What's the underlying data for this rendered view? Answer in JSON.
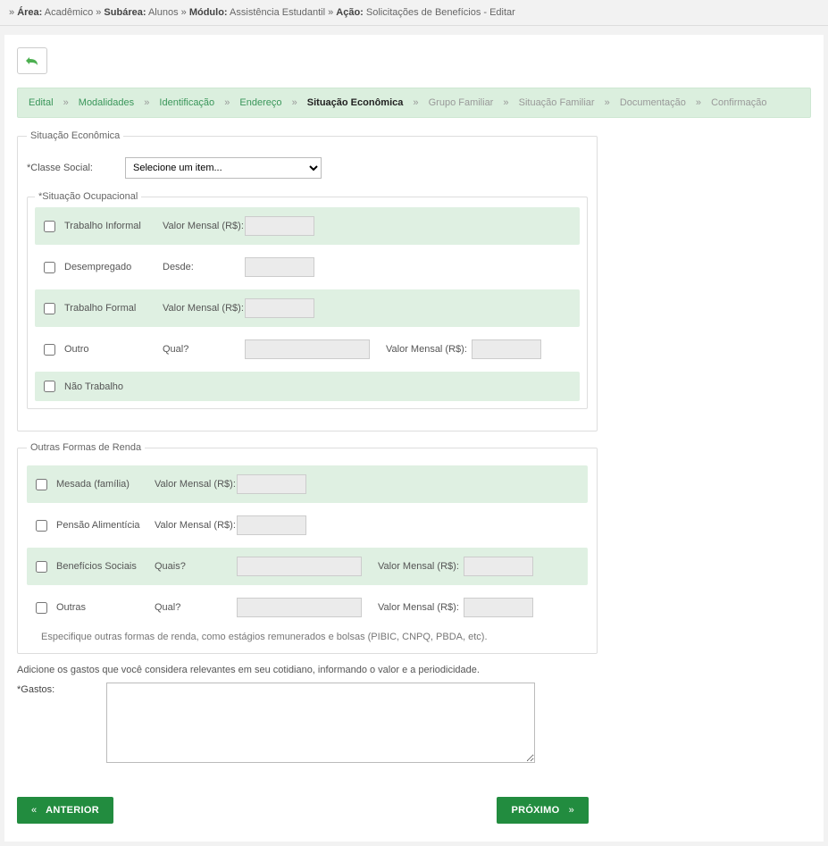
{
  "breadcrumb": {
    "area_label": "Área:",
    "area_value": "Acadêmico",
    "subarea_label": "Subárea:",
    "subarea_value": "Alunos",
    "modulo_label": "Módulo:",
    "modulo_value": "Assistência Estudantil",
    "acao_label": "Ação:",
    "acao_value": "Solicitações de Benefícios - Editar"
  },
  "steps": {
    "edital": "Edital",
    "modalidades": "Modalidades",
    "identificacao": "Identificação",
    "endereco": "Endereço",
    "situacao_economica": "Situação Econômica",
    "grupo_familiar": "Grupo Familiar",
    "situacao_familiar": "Situação Familiar",
    "documentacao": "Documentação",
    "confirmacao": "Confirmação"
  },
  "legend_main": "Situação Econômica",
  "classe_social": {
    "label": "*Classe Social:",
    "placeholder": "Selecione um item..."
  },
  "situacao_ocupacional": {
    "legend": "*Situação Ocupacional",
    "rows": {
      "trabalho_informal": {
        "label": "Trabalho Informal",
        "mid": "Valor Mensal (R$):"
      },
      "desempregado": {
        "label": "Desempregado",
        "mid": "Desde:"
      },
      "trabalho_formal": {
        "label": "Trabalho Formal",
        "mid": "Valor Mensal (R$):"
      },
      "outro": {
        "label": "Outro",
        "mid": "Qual?",
        "right": "Valor Mensal (R$):"
      },
      "nao_trabalho": {
        "label": "Não Trabalho"
      }
    }
  },
  "outras_rendas": {
    "legend": "Outras Formas de Renda",
    "rows": {
      "mesada": {
        "label": "Mesada (família)",
        "mid": "Valor Mensal (R$):"
      },
      "pensao": {
        "label": "Pensão Alimentícia",
        "mid": "Valor Mensal (R$):"
      },
      "beneficios": {
        "label": "Benefícios Sociais",
        "mid": "Quais?",
        "right": "Valor Mensal (R$):"
      },
      "outras": {
        "label": "Outras",
        "mid": "Qual?",
        "right": "Valor Mensal (R$):"
      }
    },
    "hint": "Especifique outras formas de renda, como estágios remunerados e bolsas (PIBIC, CNPQ, PBDA, etc)."
  },
  "gastos": {
    "instruction": "Adicione os gastos que você considera relevantes em seu cotidiano, informando o valor e a periodicidade.",
    "label": "*Gastos:"
  },
  "buttons": {
    "prev": "ANTERIOR",
    "next": "PRÓXIMO"
  }
}
